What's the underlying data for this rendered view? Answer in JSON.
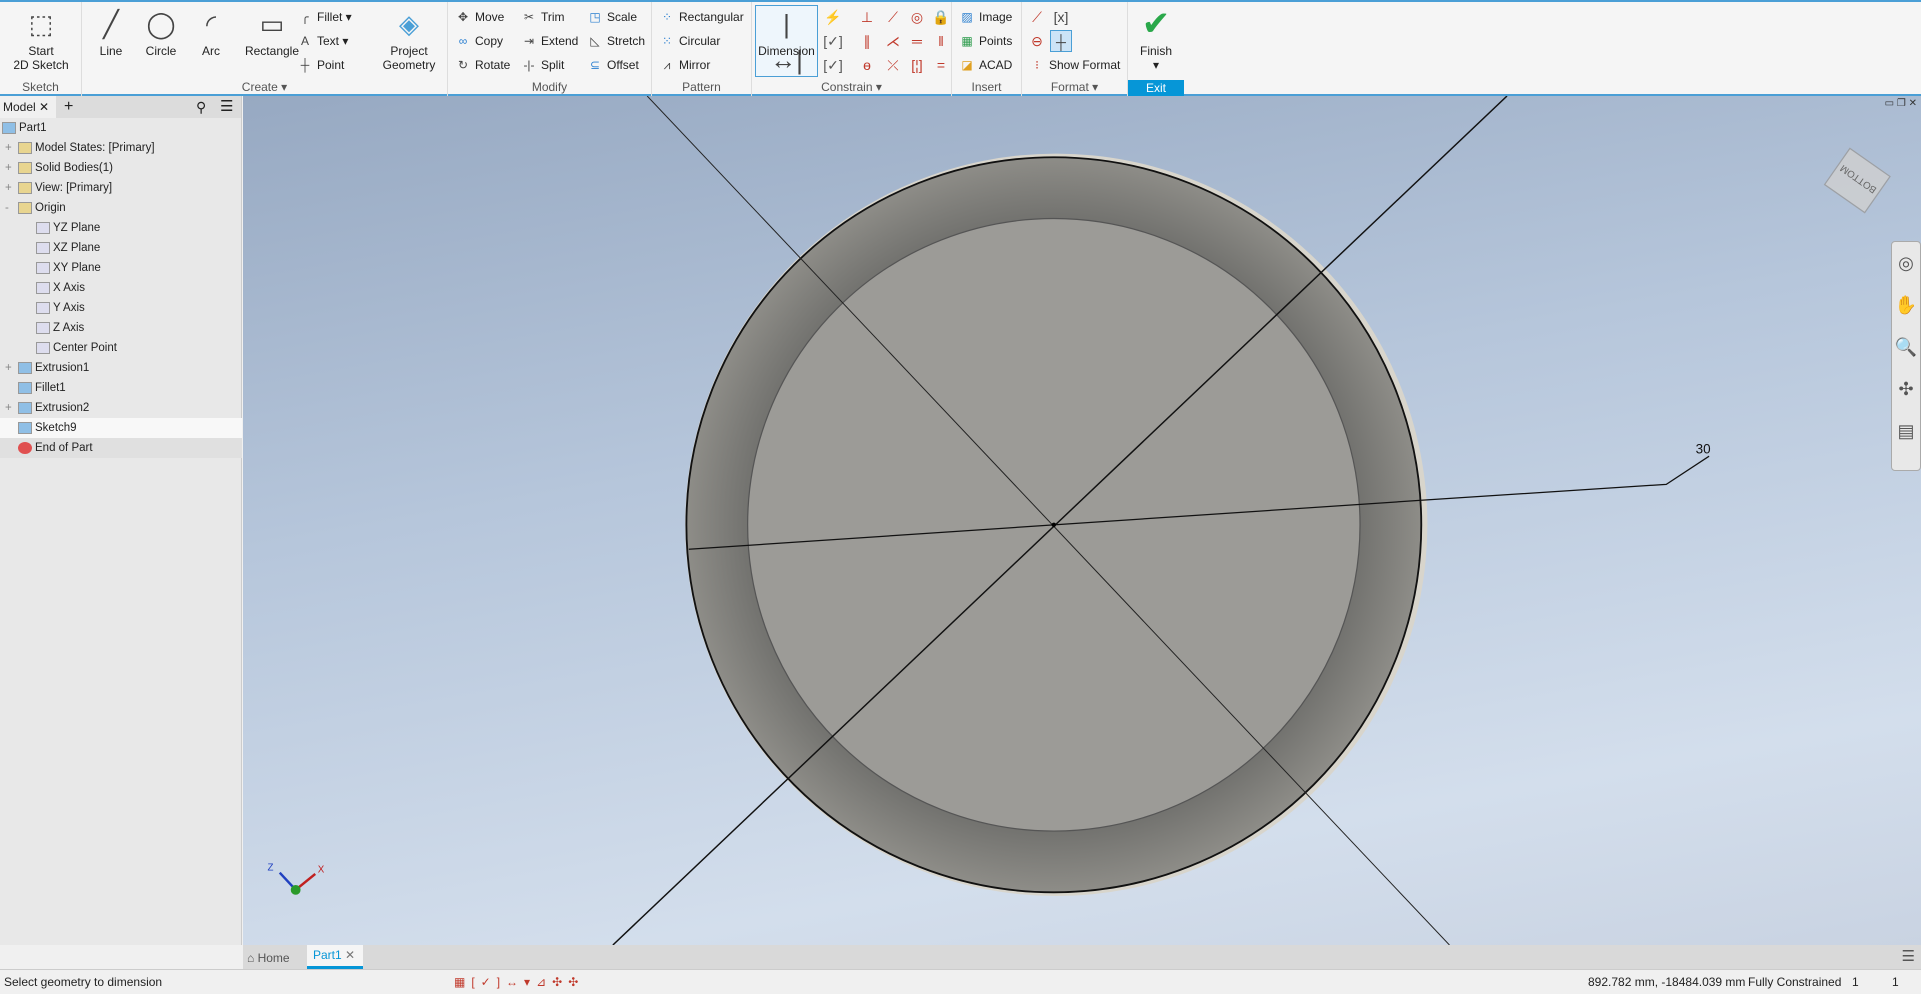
{
  "ribbon": {
    "sketch": {
      "label": "Sketch",
      "start": "Start\n2D Sketch"
    },
    "create": {
      "label": "Create",
      "line": "Line",
      "circle": "Circle",
      "arc": "Arc",
      "rectangle": "Rectangle",
      "fillet": "Fillet",
      "text": "Text",
      "point": "Point",
      "project": "Project\nGeometry"
    },
    "modify": {
      "label": "Modify",
      "move": "Move",
      "copy": "Copy",
      "rotate": "Rotate",
      "trim": "Trim",
      "extend": "Extend",
      "split": "Split",
      "scale": "Scale",
      "stretch": "Stretch",
      "offset": "Offset"
    },
    "pattern": {
      "label": "Pattern",
      "rectangular": "Rectangular",
      "circular": "Circular",
      "mirror": "Mirror"
    },
    "constrain": {
      "label": "Constrain",
      "dimension": "Dimension"
    },
    "insert": {
      "label": "Insert",
      "image": "Image",
      "points": "Points",
      "acad": "ACAD"
    },
    "format": {
      "label": "Format",
      "show_format": "Show Format"
    },
    "exit": {
      "label": "Exit",
      "finish": "Finish"
    }
  },
  "browser": {
    "tab": "Model",
    "items": [
      {
        "label": "Part1",
        "level": 0
      },
      {
        "label": "Model States: [Primary]",
        "level": 1,
        "expand": "+"
      },
      {
        "label": "Solid Bodies(1)",
        "level": 1,
        "expand": "+"
      },
      {
        "label": "View: [Primary]",
        "level": 1,
        "expand": "+"
      },
      {
        "label": "Origin",
        "level": 1,
        "expand": "-"
      },
      {
        "label": "YZ Plane",
        "level": 2
      },
      {
        "label": "XZ Plane",
        "level": 2
      },
      {
        "label": "XY Plane",
        "level": 2
      },
      {
        "label": "X Axis",
        "level": 2
      },
      {
        "label": "Y Axis",
        "level": 2
      },
      {
        "label": "Z Axis",
        "level": 2
      },
      {
        "label": "Center Point",
        "level": 2
      },
      {
        "label": "Extrusion1",
        "level": 1,
        "expand": "+"
      },
      {
        "label": "Fillet1",
        "level": 1
      },
      {
        "label": "Extrusion2",
        "level": 1,
        "expand": "+"
      },
      {
        "label": "Sketch9",
        "level": 1,
        "selected": true
      },
      {
        "label": "End of Part",
        "level": 1
      }
    ]
  },
  "viewport": {
    "dimension_value": "30",
    "viewcube_face": "BOTTOM"
  },
  "doc_tabs": {
    "home": "Home",
    "part": "Part1"
  },
  "status": {
    "message": "Select geometry to dimension",
    "coords": "892.782 mm, -18484.039 mm",
    "constraint": "Fully Constrained",
    "count1": "1",
    "count2": "1"
  },
  "colors": {
    "accent": "#0696d7",
    "finish": "#2aa84a"
  }
}
